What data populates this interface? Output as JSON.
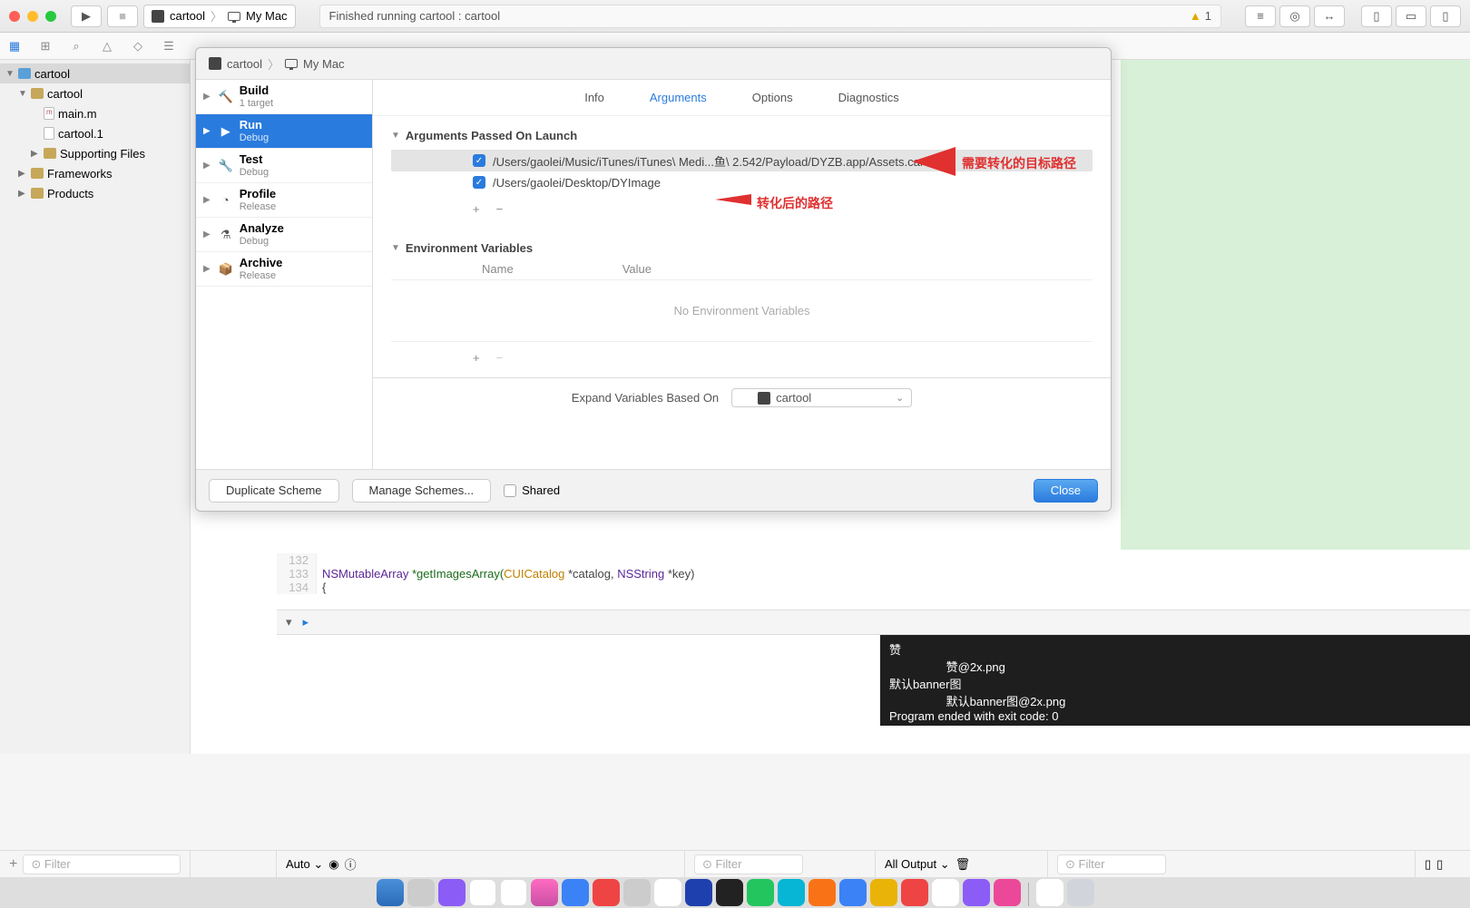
{
  "toolbar": {
    "scheme_app": "cartool",
    "scheme_dest": "My Mac",
    "status": "Finished running cartool : cartool",
    "warn_count": "1"
  },
  "navigator": {
    "root": "cartool",
    "group": "cartool",
    "file_main": "main.m",
    "file_cartool1": "cartool.1",
    "supporting": "Supporting Files",
    "frameworks": "Frameworks",
    "products": "Products"
  },
  "sheet": {
    "crumb_app": "cartool",
    "crumb_dest": "My Mac",
    "actions": {
      "build": {
        "title": "Build",
        "sub": "1 target"
      },
      "run": {
        "title": "Run",
        "sub": "Debug"
      },
      "test": {
        "title": "Test",
        "sub": "Debug"
      },
      "profile": {
        "title": "Profile",
        "sub": "Release"
      },
      "analyze": {
        "title": "Analyze",
        "sub": "Debug"
      },
      "archive": {
        "title": "Archive",
        "sub": "Release"
      }
    },
    "tabs": {
      "info": "Info",
      "arguments": "Arguments",
      "options": "Options",
      "diagnostics": "Diagnostics"
    },
    "args_header": "Arguments Passed On Launch",
    "arg1": "/Users/gaolei/Music/iTunes/iTunes\\ Medi...鱼\\ 2.542/Payload/DYZB.app/Assets.car",
    "arg2": "/Users/gaolei/Desktop/DYImage",
    "env_header": "Environment Variables",
    "env_name": "Name",
    "env_value": "Value",
    "env_empty": "No Environment Variables",
    "expand_label": "Expand Variables Based On",
    "expand_value": "cartool",
    "duplicate": "Duplicate Scheme",
    "manage": "Manage Schemes...",
    "shared": "Shared",
    "close": "Close"
  },
  "annotations": {
    "a1": "需要转化的目标路径",
    "a2": "转化后的路径"
  },
  "code": {
    "l132": "132",
    "l133": "133",
    "l134": "134",
    "line133_a": "NSMutableArray",
    "line133_b": "*getImagesArray(",
    "line133_c": "CUICatalog",
    "line133_d": " *catalog, ",
    "line133_e": "NSString",
    "line133_f": " *key)",
    "line134": "{"
  },
  "console": {
    "l1": "赞",
    "l2": "\t赞@2x.png",
    "l3": "默认banner图",
    "l4": "\t默认banner图@2x.png",
    "l5": "Program ended with exit code: 0"
  },
  "bottom": {
    "auto": "Auto ⌄",
    "filter": "Filter",
    "all_output": "All Output ⌄"
  }
}
